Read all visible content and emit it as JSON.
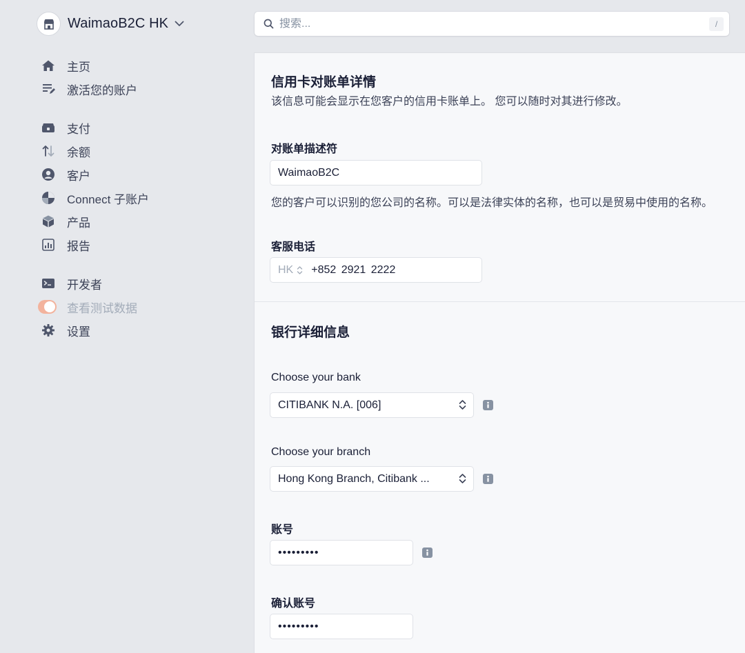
{
  "account": {
    "name": "WaimaoB2C HK"
  },
  "search": {
    "placeholder": "搜索...",
    "shortcut": "/"
  },
  "sidebar": {
    "groups": [
      {
        "items": [
          {
            "label": "主页",
            "icon": "home-icon"
          },
          {
            "label": "激活您的账户",
            "icon": "activate-account-icon"
          }
        ]
      },
      {
        "items": [
          {
            "label": "支付",
            "icon": "payments-icon"
          },
          {
            "label": "余额",
            "icon": "balances-icon"
          },
          {
            "label": "客户",
            "icon": "customers-icon"
          },
          {
            "label": "Connect 子账户",
            "icon": "connect-icon"
          },
          {
            "label": "产品",
            "icon": "products-icon"
          },
          {
            "label": "报告",
            "icon": "reports-icon"
          }
        ]
      },
      {
        "items": [
          {
            "label": "开发者",
            "icon": "terminal-icon"
          },
          {
            "label": "查看测试数据",
            "icon": "toggle",
            "toggle_on": true
          },
          {
            "label": "设置",
            "icon": "gear-icon"
          }
        ]
      }
    ]
  },
  "statement": {
    "title": "信用卡对账单详情",
    "description": "该信息可能会显示在您客户的信用卡账单上。 您可以随时对其进行修改。",
    "descriptor_label": "对账单描述符",
    "descriptor_value": "WaimaoB2C",
    "descriptor_help": "您的客户可以识别的您公司的名称。可以是法律实体的名称，也可以是贸易中使用的名称。",
    "phone_label": "客服电话",
    "phone_country": "HK",
    "phone_value": "+852  2921 2222"
  },
  "bank": {
    "title": "银行详细信息",
    "bank_label": "Choose your bank",
    "bank_value": "CITIBANK N.A. [006]",
    "branch_label": "Choose your branch",
    "branch_value": "Hong Kong Branch, Citibank ...",
    "account_label": "账号",
    "account_value": "•••••••••",
    "confirm_label": "确认账号",
    "confirm_value": "•••••••••"
  },
  "colors": {
    "background": "#e6e8ec",
    "panel": "#f7f8fa",
    "text": "#1a1f36",
    "icon": "#4f566b",
    "toggle": "#f3b39d"
  }
}
